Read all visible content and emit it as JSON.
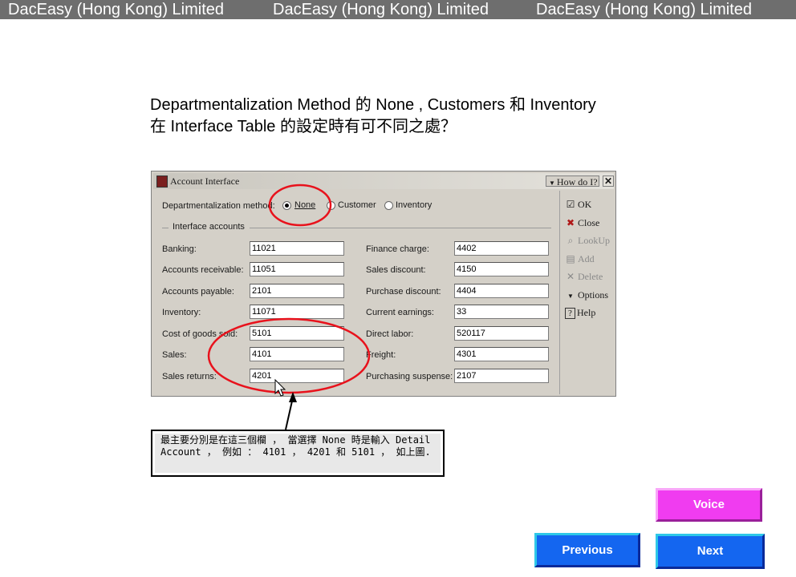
{
  "banner": {
    "items": [
      "DacEasy (Hong Kong) Limited",
      "DacEasy (Hong Kong) Limited",
      "DacEasy (Hong Kong) Limited"
    ]
  },
  "question": {
    "line1": "Departmentalization Method 的 None , Customers 和 Inventory",
    "line2": "在 Interface Table 的設定時有可不同之處？"
  },
  "window": {
    "title": "Account Interface",
    "how_do_i": "How do I?",
    "close_x": "✕",
    "dept_label": "Departmentalization method:",
    "dept_options": [
      "None",
      "Customer",
      "Inventory"
    ],
    "dept_selected": "None",
    "group_label": "Interface accounts",
    "left_fields": [
      {
        "label": "Banking:",
        "value": "11021"
      },
      {
        "label": "Accounts receivable:",
        "value": "11051"
      },
      {
        "label": "Accounts payable:",
        "value": "2101"
      },
      {
        "label": "Inventory:",
        "value": "11071"
      },
      {
        "label": "Cost of goods sold:",
        "value": "5101"
      },
      {
        "label": "Sales:",
        "value": "4101"
      },
      {
        "label": "Sales returns:",
        "value": "4201"
      }
    ],
    "right_fields": [
      {
        "label": "Finance charge:",
        "value": "4402"
      },
      {
        "label": "Sales discount:",
        "value": "4150"
      },
      {
        "label": "Purchase discount:",
        "value": "4404"
      },
      {
        "label": "Current earnings:",
        "value": "33"
      },
      {
        "label": "Direct labor:",
        "value": "520117"
      },
      {
        "label": "Freight:",
        "value": "4301"
      },
      {
        "label": "Purchasing suspense:",
        "value": "2107"
      }
    ],
    "side_buttons": [
      {
        "label": "OK",
        "icon": "ok-icon",
        "enabled": true
      },
      {
        "label": "Close",
        "icon": "close-icon",
        "enabled": true
      },
      {
        "label": "LookUp",
        "icon": "lookup-icon",
        "enabled": false
      },
      {
        "label": "Add",
        "icon": "add-icon",
        "enabled": false
      },
      {
        "label": "Delete",
        "icon": "delete-icon",
        "enabled": false
      },
      {
        "label": "Options",
        "icon": "options-icon",
        "enabled": true
      },
      {
        "label": "Help",
        "icon": "help-icon",
        "enabled": true
      }
    ]
  },
  "callout": {
    "text": "最主要分別是在這三個欄 ， 當選擇 None 時是輸入 Detail Account ， 例如 ： 4101 ， 4201 和 5101 ， 如上圖."
  },
  "nav": {
    "voice": "Voice",
    "previous": "Previous",
    "next": "Next"
  },
  "colors": {
    "banner_bg": "#6e6e6e",
    "annotation_red": "#e8121c",
    "voice_bg": "#f03cf0",
    "nav_bg": "#1466f0"
  }
}
